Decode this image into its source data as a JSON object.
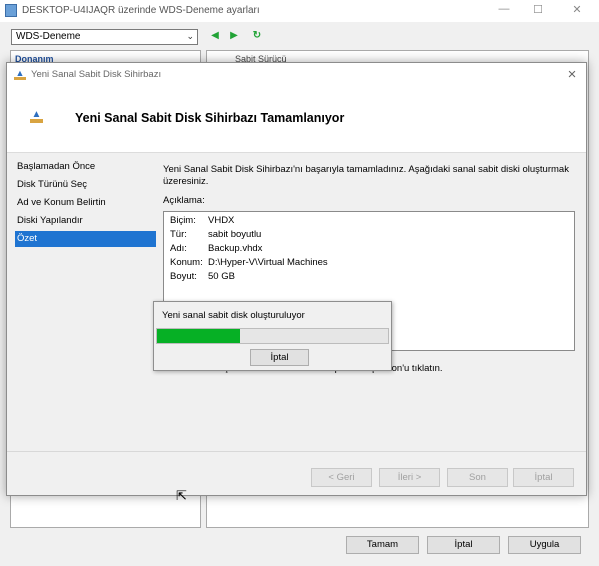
{
  "bg_window": {
    "title": "DESKTOP-U4IJAQR üzerinde WDS-Deneme ayarları",
    "vm_selector": "WDS-Deneme",
    "left_item": "Donanım",
    "right_item": "Sabit Sürücü",
    "buttons": {
      "ok": "Tamam",
      "cancel": "İptal",
      "apply": "Uygula"
    },
    "controls": {
      "minimize": "—",
      "maximize": "☐",
      "close": "✕"
    }
  },
  "wizard": {
    "title": "Yeni Sanal Sabit Disk Sihirbazı",
    "heading": "Yeni Sanal Sabit Disk Sihirbazı Tamamlanıyor",
    "steps": [
      "Başlamadan Önce",
      "Disk Türünü Seç",
      "Ad ve Konum Belirtin",
      "Diski Yapılandır",
      "Özet"
    ],
    "selected_step": "Özet",
    "intro": "Yeni Sanal Sabit Disk Sihirbazı'nı başarıyla tamamladınız. Aşağıdaki sanal sabit diski oluşturmak üzeresiniz.",
    "description_label": "Açıklama:",
    "summary": [
      {
        "key": "Biçim:",
        "value": "VHDX"
      },
      {
        "key": "Tür:",
        "value": "sabit boyutlu"
      },
      {
        "key": "Adı:",
        "value": "Backup.vhdx"
      },
      {
        "key": "Konum:",
        "value": "D:\\Hyper-V\\Virtual Machines"
      },
      {
        "key": "Boyut:",
        "value": "50 GB"
      }
    ],
    "finish_note": "Sanal diski oluşturmak ve bu sihirbazı kapatmak için Son'u tıklatın.",
    "buttons": {
      "back": "< Geri",
      "next": "İleri >",
      "finish": "Son",
      "cancel": "İptal"
    }
  },
  "progress": {
    "message": "Yeni sanal sabit disk oluşturuluyor",
    "percent": 36,
    "cancel": "İptal"
  },
  "colors": {
    "accent": "#1f74d1",
    "progress": "#06b025",
    "nav_arrow": "#21a336"
  }
}
